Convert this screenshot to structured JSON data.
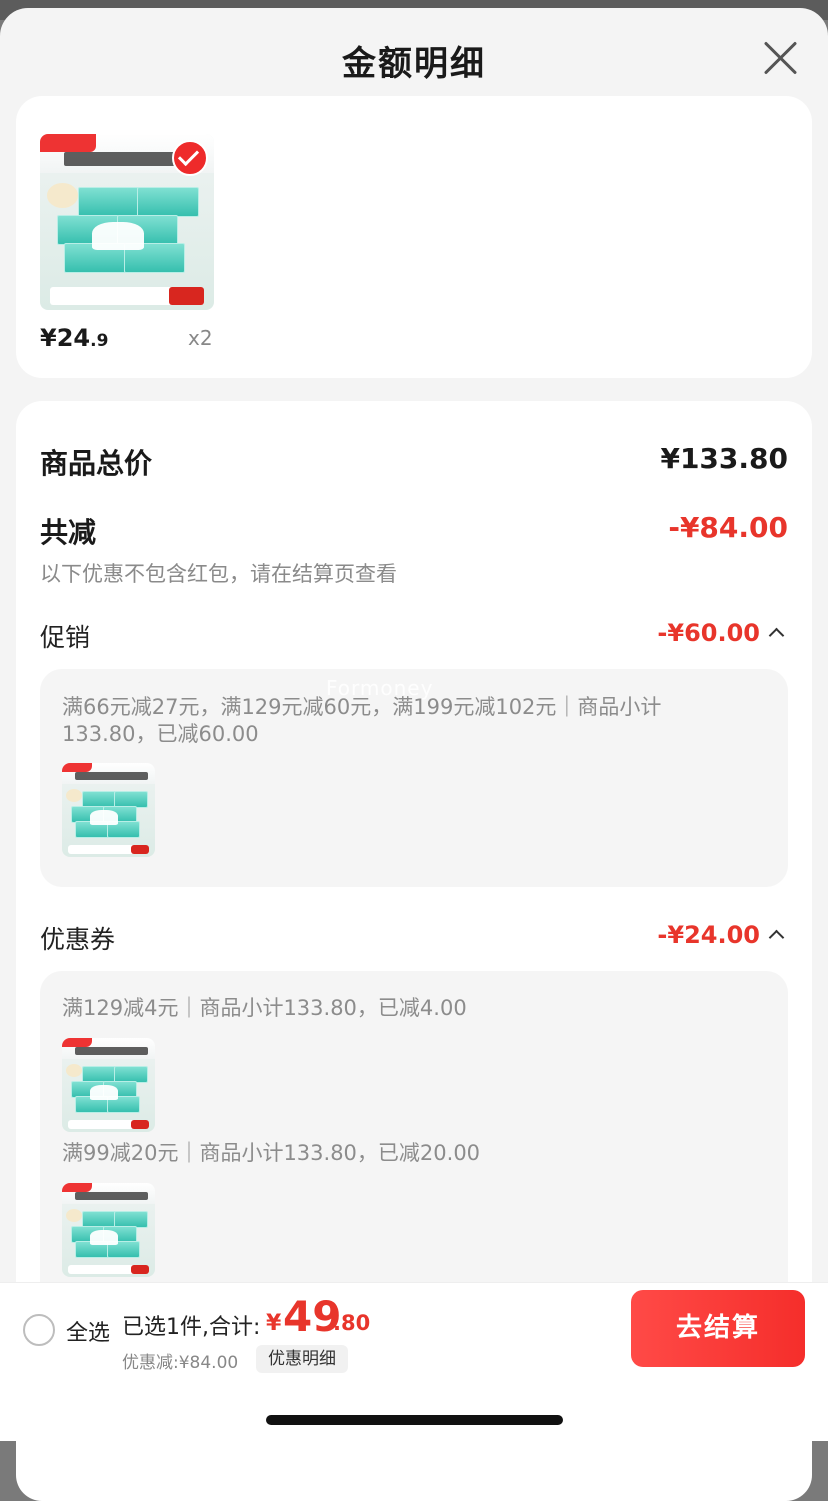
{
  "header": {
    "title": "金额明细"
  },
  "product": {
    "price_int": "¥24",
    "price_dec": ".9",
    "quantity": "x2"
  },
  "summary": {
    "total_label": "商品总价",
    "total_value": "¥133.80",
    "reduction_label": "共减",
    "reduction_value": "-¥84.00",
    "note": "以下优惠不包含红包，请在结算页查看"
  },
  "promotion": {
    "label": "促销",
    "value": "-¥60.00",
    "rule_text": "满66元减27元，满129元减60元，满199元减102元｜商品小计133.80，已减60.00",
    "watermark": "Formoney"
  },
  "coupon": {
    "label": "优惠券",
    "value": "-¥24.00",
    "rules": [
      "满129减4元｜商品小计133.80，已减4.00",
      "满99减20元｜商品小计133.80，已减20.00"
    ]
  },
  "footer": {
    "select_all": "全选",
    "selected_summary": "已选1件,合计:",
    "total_currency": "¥",
    "total_int": "49",
    "total_dec": ".80",
    "discount_note": "优惠减:¥84.00",
    "detail_link": "优惠明细",
    "checkout": "去结算"
  },
  "colors": {
    "accent": "#e8352b",
    "checkout_bg": "#f52e2b"
  }
}
